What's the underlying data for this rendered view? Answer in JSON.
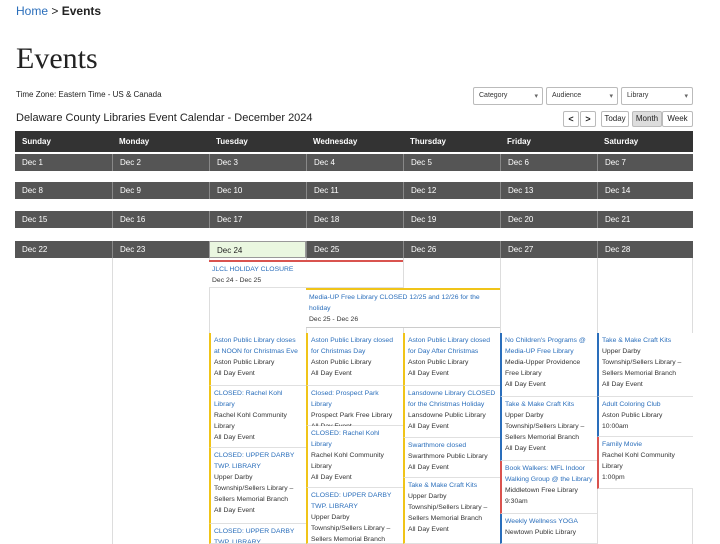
{
  "breadcrumb": {
    "home": "Home",
    "sep": ">",
    "current": "Events"
  },
  "page_title": "Events",
  "timezone": "Time Zone: Eastern Time - US & Canada",
  "filters": {
    "category": "Category",
    "audience": "Audience",
    "library": "Library"
  },
  "calendar_title": "Delaware County Libraries Event Calendar - December 2024",
  "nav": {
    "prev": "<",
    "next": ">",
    "today": "Today",
    "month": "Month",
    "week": "Week"
  },
  "weekdays": [
    "Sunday",
    "Monday",
    "Tuesday",
    "Wednesday",
    "Thursday",
    "Friday",
    "Saturday"
  ],
  "weeks": [
    [
      "Dec 1",
      "Dec 2",
      "Dec 3",
      "Dec 4",
      "Dec 5",
      "Dec 6",
      "Dec 7"
    ],
    [
      "Dec 8",
      "Dec 9",
      "Dec 10",
      "Dec 11",
      "Dec 12",
      "Dec 13",
      "Dec 14"
    ],
    [
      "Dec 15",
      "Dec 16",
      "Dec 17",
      "Dec 18",
      "Dec 19",
      "Dec 20",
      "Dec 21"
    ],
    [
      "Dec 22",
      "Dec 23",
      "Dec 24",
      "Dec 25",
      "Dec 26",
      "Dec 27",
      "Dec 28"
    ]
  ],
  "multi_events": [
    {
      "title": "JLCL HOLIDAY CLOSURE",
      "dates": "Dec 24 - Dec 25"
    },
    {
      "title": "Media-UP Free Library CLOSED 12/25 and 12/26 for the holiday",
      "dates": "Dec 25 - Dec 26"
    }
  ],
  "events": {
    "tue": [
      {
        "title": "Aston Public Library closes at NOON for Christmas Eve",
        "lines": [
          "Aston Public Library",
          "All Day Event"
        ]
      },
      {
        "title": "CLOSED: Rachel Kohl Library",
        "lines": [
          "Rachel Kohl Community Library",
          "All Day Event"
        ]
      },
      {
        "title": "CLOSED: UPPER DARBY TWP. LIBRARY",
        "lines": [
          "Upper Darby Township/Sellers Library – Sellers Memorial Branch",
          "All Day Event"
        ]
      },
      {
        "title": "CLOSED: UPPER DARBY TWP. LIBRARY",
        "lines": []
      }
    ],
    "wed": [
      {
        "title": "Aston Public Library closed for Christmas Day",
        "lines": [
          "Aston Public Library",
          "All Day Event"
        ]
      },
      {
        "title": "Closed: Prospect Park Library",
        "lines": [
          "Prospect Park Free Library",
          "All Day Event"
        ]
      },
      {
        "title": "CLOSED: Rachel Kohl Library",
        "lines": [
          "Rachel Kohl Community Library",
          "All Day Event"
        ]
      },
      {
        "title": "CLOSED: UPPER DARBY TWP. LIBRARY",
        "lines": [
          "Upper Darby Township/Sellers Library – Sellers Memorial Branch"
        ]
      }
    ],
    "thu": [
      {
        "title": "Aston Public Library closed for Day After Christmas",
        "lines": [
          "Aston Public Library",
          "All Day Event"
        ]
      },
      {
        "title": "Lansdowne Library CLOSED for the Christmas Holiday",
        "lines": [
          "Lansdowne Public Library",
          "All Day Event"
        ]
      },
      {
        "title": "Swarthmore closed",
        "lines": [
          "Swarthmore Public Library",
          "All Day Event"
        ]
      },
      {
        "title": "Take & Make Craft Kits",
        "lines": [
          "Upper Darby Township/Sellers Library – Sellers Memorial Branch",
          "All Day Event"
        ]
      }
    ],
    "fri": [
      {
        "title": "No Children's Programs @ Media-UP Free Library",
        "lines": [
          "Media-Upper Providence Free Library",
          "All Day Event"
        ]
      },
      {
        "title": "Take & Make Craft Kits",
        "lines": [
          "Upper Darby Township/Sellers Library – Sellers Memorial Branch",
          "All Day Event"
        ]
      },
      {
        "title": "Book Walkers: MFL Indoor Walking Group @ the Library",
        "lines": [
          "Middletown Free Library",
          "9:30am"
        ]
      },
      {
        "title": "Weekly Wellness YOGA",
        "lines": [
          "Newtown Public Library"
        ]
      }
    ],
    "sat": [
      {
        "title": "Take & Make Craft Kits",
        "lines": [
          "Upper Darby Township/Sellers Library – Sellers Memorial Branch",
          "All Day Event"
        ]
      },
      {
        "title": "Adult Coloring Club",
        "lines": [
          "Aston Public Library",
          "10:00am"
        ]
      },
      {
        "title": "Family Movie",
        "lines": [
          "Rachel Kohl Community Library",
          "1:00pm"
        ]
      }
    ]
  }
}
